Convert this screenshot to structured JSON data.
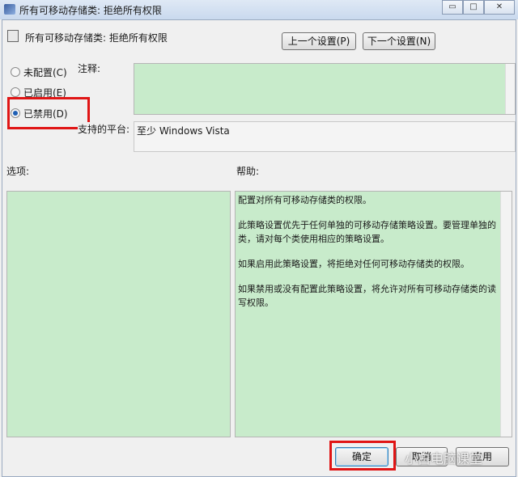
{
  "window": {
    "title": "所有可移动存储类: 拒绝所有权限",
    "minimize": "▭",
    "maximize": "□",
    "close": "✕"
  },
  "header": {
    "title": "所有可移动存储类: 拒绝所有权限",
    "prev": "上一个设置(P)",
    "next": "下一个设置(N)"
  },
  "radios": [
    {
      "label": "未配置(C)",
      "checked": false
    },
    {
      "label": "已启用(E)",
      "checked": false
    },
    {
      "label": "已禁用(D)",
      "checked": true
    }
  ],
  "comment_label": "注释:",
  "platform_label": "支持的平台:",
  "platform_value": "至少 Windows Vista",
  "options_label": "选项:",
  "help_label": "帮助:",
  "help": [
    "配置对所有可移动存储类的权限。",
    "此策略设置优先于任何单独的可移动存储策略设置。要管理单独的类，请对每个类使用相应的策略设置。",
    "如果启用此策略设置，将拒绝对任何可移动存储类的权限。",
    "如果禁用或没有配置此策略设置，将允许对所有可移动存储类的读写权限。"
  ],
  "buttons": {
    "ok": "确定",
    "cancel": "取消",
    "apply": "应用"
  },
  "watermark": "小白电脑课堂"
}
